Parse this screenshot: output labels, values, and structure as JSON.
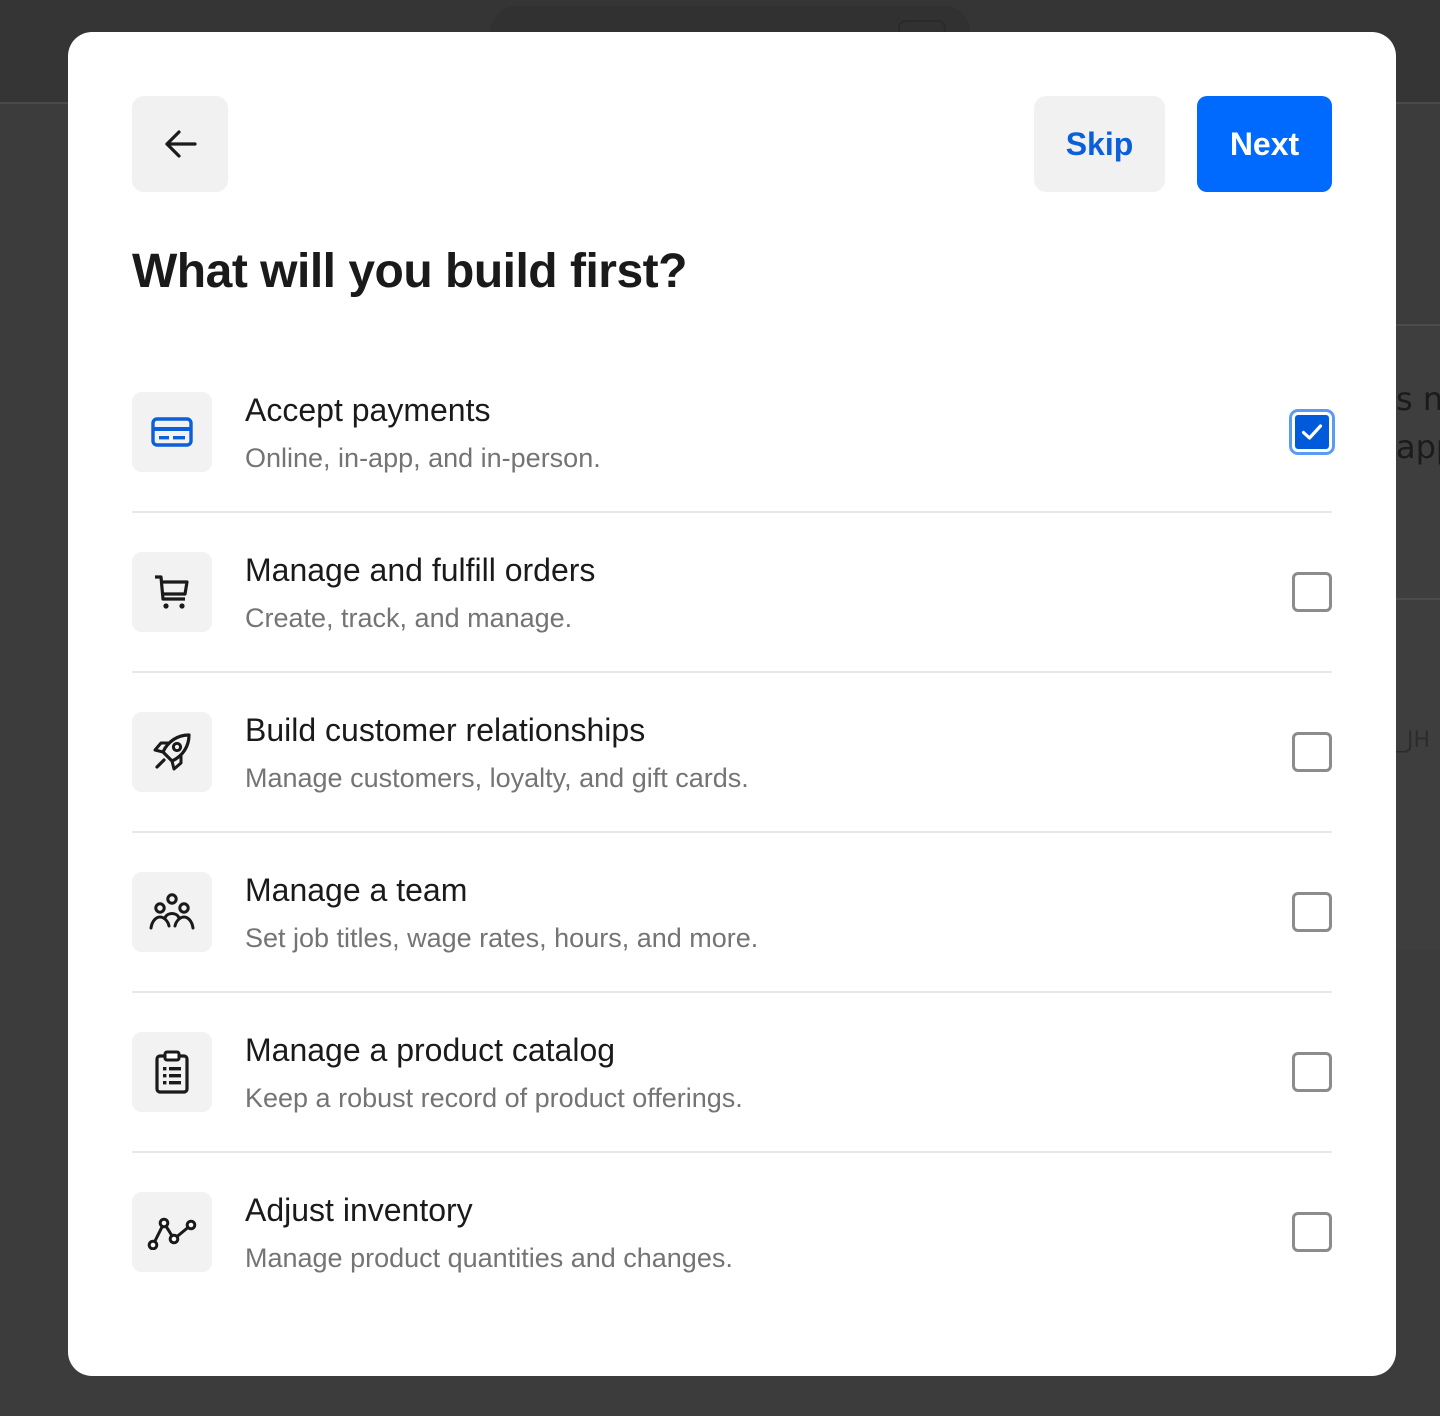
{
  "background": {
    "peek_lines": [
      "s n",
      "app",
      "_JH"
    ]
  },
  "modal": {
    "back_icon": "arrow-left-icon",
    "skip_label": "Skip",
    "next_label": "Next",
    "title": "What will you build first?",
    "colors": {
      "primary": "#006aff",
      "skip_text": "#0b5fd9",
      "checked": "#005ad9"
    },
    "options": [
      {
        "icon": "credit-card-icon",
        "title": "Accept payments",
        "description": "Online, in-app, and in-person.",
        "checked": true
      },
      {
        "icon": "cart-icon",
        "title": "Manage and fulfill orders",
        "description": "Create, track, and manage.",
        "checked": false
      },
      {
        "icon": "rocket-icon",
        "title": "Build customer relationships",
        "description": "Manage customers, loyalty, and gift cards.",
        "checked": false
      },
      {
        "icon": "team-icon",
        "title": "Manage a team",
        "description": "Set job titles, wage rates, hours, and more.",
        "checked": false
      },
      {
        "icon": "clipboard-list-icon",
        "title": "Manage a product catalog",
        "description": "Keep a robust record of product offerings.",
        "checked": false
      },
      {
        "icon": "line-graph-icon",
        "title": "Adjust inventory",
        "description": "Manage product quantities and changes.",
        "checked": false
      }
    ]
  }
}
